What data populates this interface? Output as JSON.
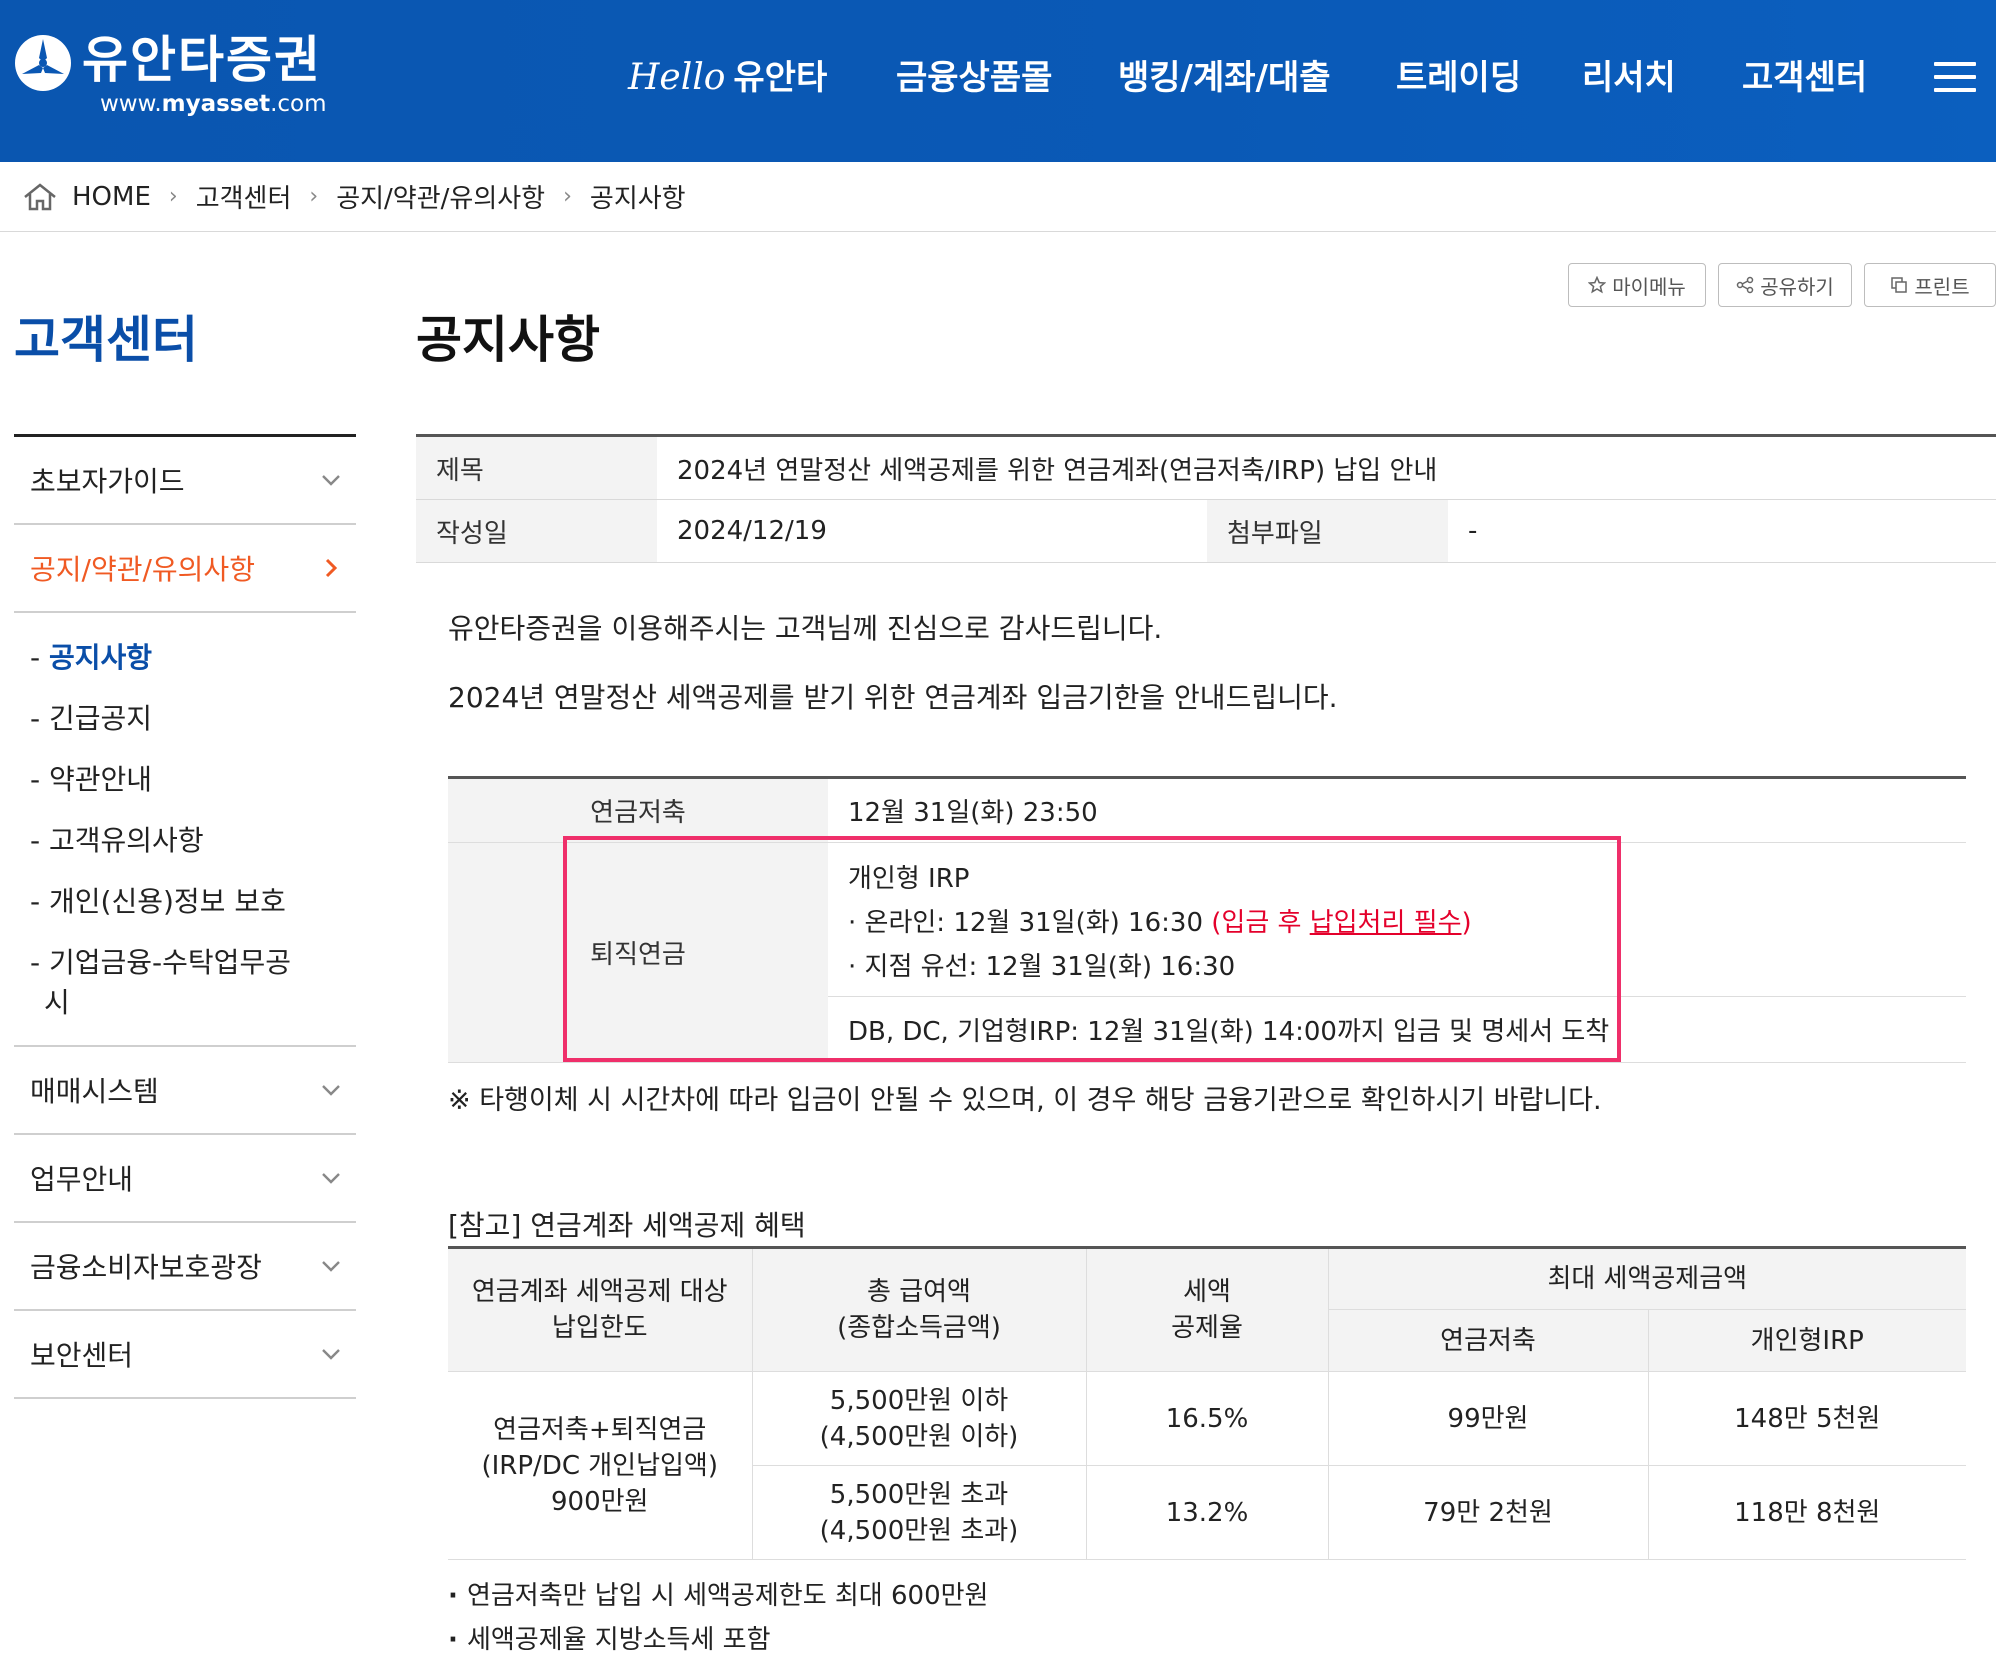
{
  "header": {
    "logo_name": "유안타증권",
    "logo_url_prefix": "www.",
    "logo_url_bold": "myasset",
    "logo_url_suffix": ".com",
    "nav": {
      "hello_script": "Hello",
      "hello_rest": "유안타",
      "item2": "금융상품몰",
      "item3": "뱅킹/계좌/대출",
      "item4": "트레이딩",
      "item5": "리서치",
      "item6": "고객센터"
    },
    "bg_color": "#0a57b3"
  },
  "breadcrumb": {
    "home": "HOME",
    "level1": "고객센터",
    "level2": "공지/약관/유의사항",
    "level3": "공지사항"
  },
  "sidebar": {
    "title": "고객센터",
    "item_beginner": "초보자가이드",
    "item_notice_terms": "공지/약관/유의사항",
    "sub": {
      "notice": "공지사항",
      "urgent": "긴급공지",
      "terms": "약관안내",
      "caution": "고객유의사항",
      "privacy": "개인(신용)정보 보호",
      "corp_line1": "기업금융-수탁업무공",
      "corp_line2": "시"
    },
    "item_trading_system": "매매시스템",
    "item_business": "업무안내",
    "item_consumer": "금융소비자보호광장",
    "item_security": "보안센터",
    "accent_color": "#f05a23",
    "title_color": "#0a4ea8"
  },
  "tools": {
    "mymenu": "마이메뉴",
    "share": "공유하기",
    "print": "프린트"
  },
  "page": {
    "title": "공지사항"
  },
  "info": {
    "subject_label": "제목",
    "subject_value": "2024년 연말정산 세액공제를 위한 연금계좌(연금저축/IRP) 납입 안내",
    "date_label": "작성일",
    "date_value": "2024/12/19",
    "attach_label": "첨부파일",
    "attach_value": "-"
  },
  "content": {
    "greeting": "유안타증권을 이용해주시는 고객님께 진심으로 감사드립니다.",
    "intro": "2024년 연말정산 세액공제를 받기 위한 연금계좌 입금기한을 안내드립니다.",
    "deadline": {
      "pension_savings_label": "연금저축",
      "pension_savings_value": "12월 31일(화) 23:50",
      "retirement_label": "퇴직연금",
      "irp_title": "개인형 IRP",
      "online_prefix": "· 온라인: 12월 31일(화) 16:30 ",
      "online_red_open": "(입금 후 ",
      "online_red_underlined": "납입처리 필수",
      "online_red_close": ")",
      "branch": "· 지점 유선: 12월 31일(화) 16:30",
      "db_dc": "DB, DC, 기업형IRP: 12월 31일(화) 14:00까지 입금 및 명세서 도착"
    },
    "note": "※ 타행이체 시 시간차에 따라 입금이 안될 수 있으며, 이 경우 해당 금융기관으로 확인하시기 바랍니다.",
    "ref_title": "[참고] 연금계좌 세액공제 혜택",
    "benefit": {
      "h_limit_1": "연금계좌 세액공제 대상",
      "h_limit_2": "납입한도",
      "h_salary_1": "총 급여액",
      "h_salary_2": "(종합소득금액)",
      "h_rate_1": "세액",
      "h_rate_2": "공제율",
      "h_max": "최대 세액공제금액",
      "h_savings": "연금저축",
      "h_irp": "개인형IRP",
      "limit_1": "연금저축+퇴직연금",
      "limit_2": "(IRP/DC 개인납입액)",
      "limit_3": "900만원",
      "rows": [
        {
          "salary_1": "5,500만원 이하",
          "salary_2": "(4,500만원 이하)",
          "rate": "16.5%",
          "savings": "99만원",
          "irp": "148만 5천원"
        },
        {
          "salary_1": "5,500만원 초과",
          "salary_2": "(4,500만원 초과)",
          "rate": "13.2%",
          "savings": "79만 2천원",
          "irp": "118만 8천원"
        }
      ]
    },
    "bullet_1": "연금저축만 납입 시 세액공제한도 최대 600만원",
    "bullet_2": "세액공제율 지방소득세 포함",
    "highlight_color": "#ef2f6a"
  }
}
